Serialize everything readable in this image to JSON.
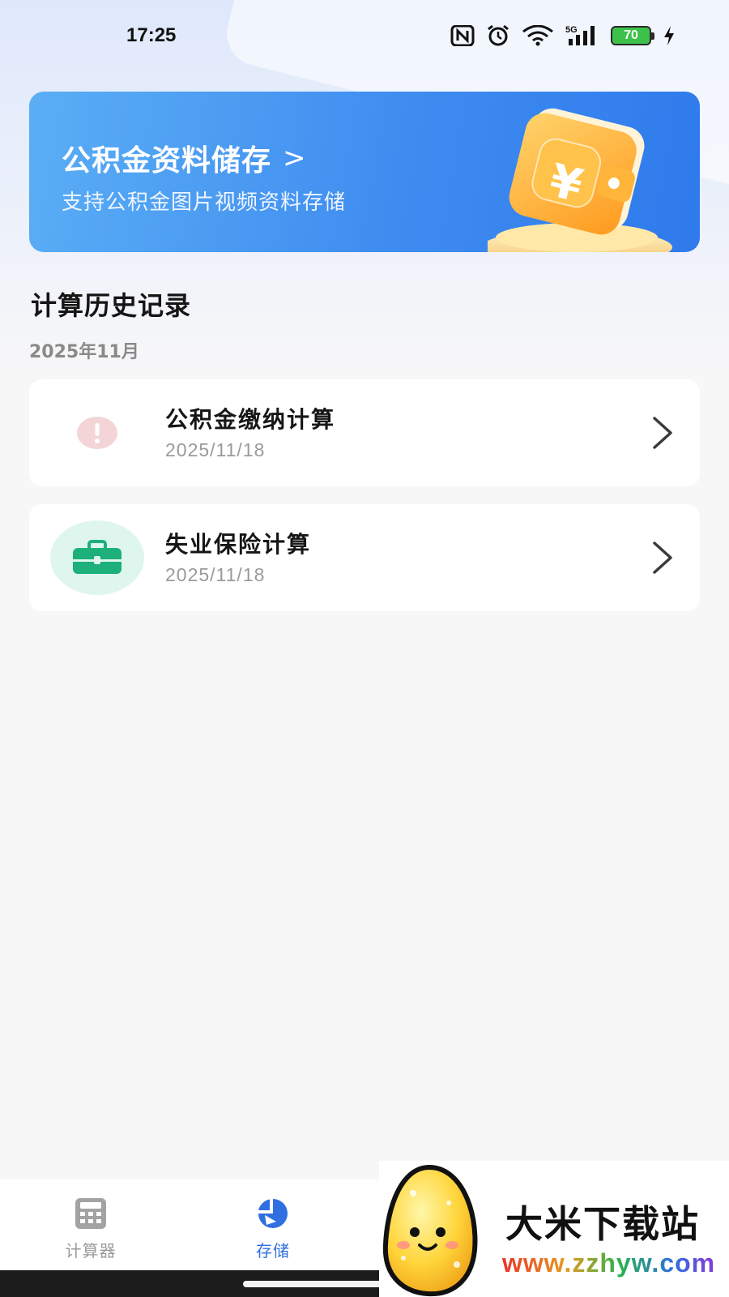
{
  "status_bar": {
    "time": "17:25",
    "battery": "70",
    "icons": [
      "nfc-icon",
      "alarm-icon",
      "wifi-icon",
      "5g-signal-icon",
      "battery-icon",
      "charging-icon"
    ],
    "network": "5G"
  },
  "banner": {
    "title": "公积金资料储存",
    "chevron": ">",
    "subtitle": "支持公积金图片视频资料存储",
    "currency_symbol": "¥"
  },
  "history": {
    "title": "计算历史记录",
    "month": "2025年11月",
    "items": [
      {
        "title": "公积金缴纳计算",
        "date": "2025/11/18",
        "icon": "alert-icon"
      },
      {
        "title": "失业保险计算",
        "date": "2025/11/18",
        "icon": "briefcase-icon"
      }
    ]
  },
  "tabbar": {
    "tabs": [
      {
        "label": "计算器",
        "icon": "calculator-icon",
        "active": false
      },
      {
        "label": "存储",
        "icon": "storage-icon",
        "active": true
      }
    ]
  },
  "watermark": {
    "title": "大米下载站",
    "url": "www.zzhyw.com"
  },
  "colors": {
    "accent": "#2f6fe0",
    "banner_start": "#5aaef5",
    "banner_end": "#2f7aec",
    "alert_bg": "#f3d5d8",
    "alert_fg": "#e58e99",
    "briefcase_bg": "#dff6ef",
    "briefcase_fg": "#1db07a",
    "inactive_tab": "#9a9a9a"
  }
}
